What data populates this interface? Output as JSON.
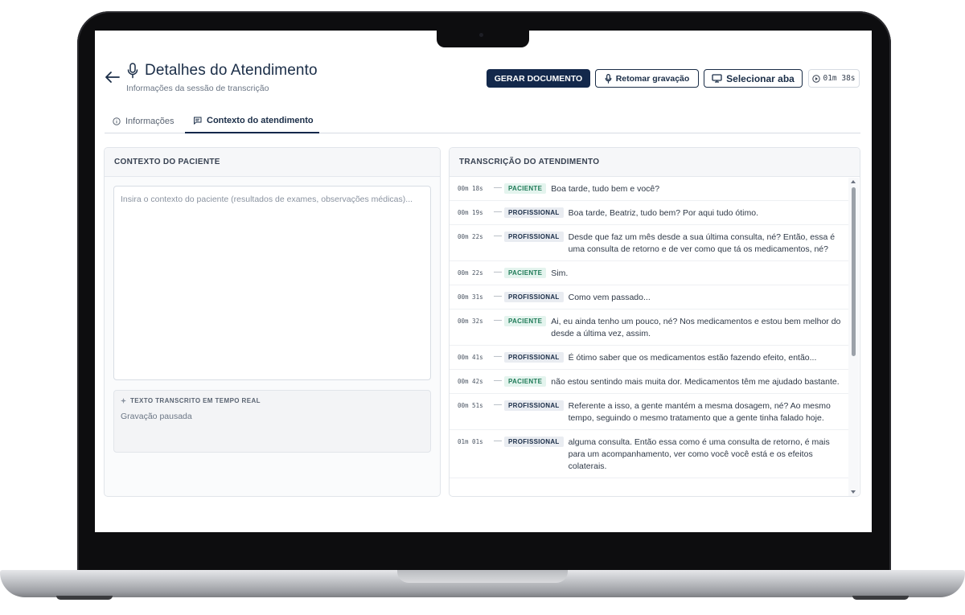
{
  "header": {
    "title": "Detalhes do Atendimento",
    "subtitle": "Informações da sessão de transcrição"
  },
  "actions": {
    "generate_label": "GERAR DOCUMENTO",
    "resume_label": "Retomar gravação",
    "select_tab_label": "Selecionar aba",
    "timer": "01m 38s"
  },
  "tabs": [
    {
      "label": "Informações",
      "icon": "info-icon",
      "active": false
    },
    {
      "label": "Contexto do atendimento",
      "icon": "chat-icon",
      "active": true
    }
  ],
  "patient_context": {
    "heading": "CONTEXTO DO PACIENTE",
    "placeholder": "Insira o contexto do paciente (resultados de exames, observações médicas)...",
    "live_label": "TEXTO TRANSCRITO EM TEMPO REAL",
    "live_status": "Gravação pausada"
  },
  "transcript": {
    "heading": "TRANSCRIÇÃO DO ATENDIMENTO",
    "entries": [
      {
        "time": "00m 18s",
        "role": "PACIENTE",
        "text": "Boa tarde, tudo bem e você?"
      },
      {
        "time": "00m 19s",
        "role": "PROFISSIONAL",
        "text": "Boa tarde, Beatriz, tudo bem? Por aqui tudo ótimo."
      },
      {
        "time": "00m 22s",
        "role": "PROFISSIONAL",
        "text": "Desde que faz um mês desde a sua última consulta, né? Então, essa é uma consulta de retorno e de ver como que tá os medicamentos, né?"
      },
      {
        "time": "00m 22s",
        "role": "PACIENTE",
        "text": "Sim."
      },
      {
        "time": "00m 31s",
        "role": "PROFISSIONAL",
        "text": "Como vem passado..."
      },
      {
        "time": "00m 32s",
        "role": "PACIENTE",
        "text": "Ai, eu ainda tenho um pouco, né? Nos medicamentos e estou bem melhor do desde a última vez, assim."
      },
      {
        "time": "00m 41s",
        "role": "PROFISSIONAL",
        "text": "É ótimo saber que os medicamentos estão fazendo efeito, então..."
      },
      {
        "time": "00m 42s",
        "role": "PACIENTE",
        "text": "não estou sentindo mais muita dor. Medicamentos têm me ajudado bastante."
      },
      {
        "time": "00m 51s",
        "role": "PROFISSIONAL",
        "text": "Referente a isso, a gente mantém a mesma dosagem, né? Ao mesmo tempo, seguindo o mesmo tratamento que a gente tinha falado hoje."
      },
      {
        "time": "01m 01s",
        "role": "PROFISSIONAL",
        "text": "alguma consulta. Então essa como é uma consulta de retorno, é mais para um acompanhamento, ver como você você está e os efeitos colaterais."
      }
    ]
  },
  "colors": {
    "navy": "#13284b",
    "patient_badge_bg": "#e4f4ee",
    "patient_badge_text": "#1e7a57",
    "pro_badge_bg": "#e9ecf1"
  }
}
